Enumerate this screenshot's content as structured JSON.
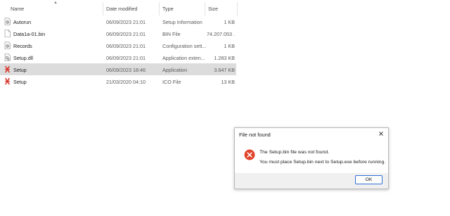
{
  "columns": {
    "name": "Name",
    "date": "Date modified",
    "type": "Type",
    "size": "Size"
  },
  "files": [
    {
      "name": "Autorun",
      "date": "06/09/2023 21:01",
      "type": "Setup Information",
      "size": "1 KB",
      "icon": "settings-file-icon"
    },
    {
      "name": "Data1a-01.bin",
      "date": "06/09/2023 21:01",
      "type": "BIN File",
      "size": "74.207.053 ...",
      "icon": "bin-file-icon"
    },
    {
      "name": "Records",
      "date": "06/09/2023 21:01",
      "type": "Configuration sett...",
      "size": "1 KB",
      "icon": "config-file-icon"
    },
    {
      "name": "Setup.dll",
      "date": "06/09/2023 21:01",
      "type": "Application exten...",
      "size": "1.283 KB",
      "icon": "dll-file-icon"
    },
    {
      "name": "Setup",
      "date": "06/09/2023 18:46",
      "type": "Application",
      "size": "3.647 KB",
      "icon": "setup-app-icon",
      "selected": true
    },
    {
      "name": "Setup",
      "date": "21/03/2020 04:10",
      "type": "ICO File",
      "size": "13 KB",
      "icon": "setup-ico-icon"
    }
  ],
  "dialog": {
    "title": "File not found",
    "message_line1": "The Setup.bin file was not found.",
    "message_line2": "You must place Setup.bin next to Setup.exe before running.",
    "ok_label": "OK"
  },
  "colors": {
    "selected_row": "#dcdcdc",
    "error_red": "#e0442a",
    "ok_border": "#2f6fd6",
    "setup_icon_red": "#d8342a"
  }
}
